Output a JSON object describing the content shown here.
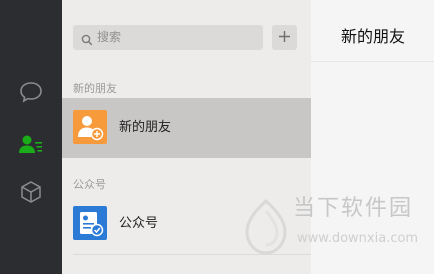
{
  "nav": {
    "items": [
      {
        "name": "chat",
        "icon": "chat-bubble-icon"
      },
      {
        "name": "contacts",
        "icon": "contacts-icon",
        "active": true
      },
      {
        "name": "favorites",
        "icon": "cube-icon"
      }
    ],
    "accent": "#1aad19"
  },
  "search": {
    "placeholder": "搜索",
    "add_icon": "plus-icon"
  },
  "sections": [
    {
      "header": "新的朋友",
      "items": [
        {
          "label": "新的朋友",
          "icon": "new-friend-icon",
          "selected": true,
          "color": "#f79a3b"
        }
      ]
    },
    {
      "header": "公众号",
      "items": [
        {
          "label": "公众号",
          "icon": "official-account-icon",
          "selected": false,
          "color": "#2b7bd6"
        }
      ]
    }
  ],
  "panel": {
    "title": "新的朋友"
  },
  "watermark": {
    "text": "当下软件园",
    "url": "www.downxia.com"
  }
}
